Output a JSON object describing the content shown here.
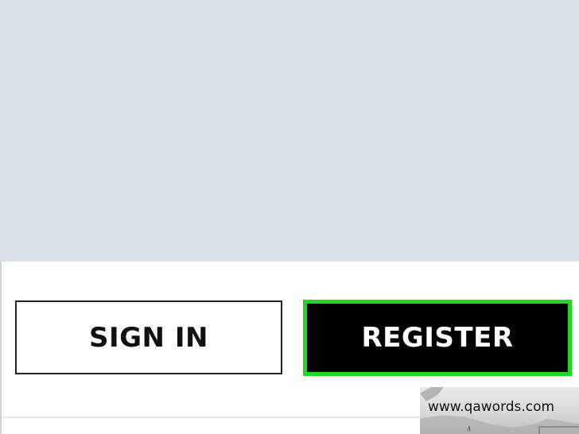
{
  "auth": {
    "sign_in_label": "SIGN IN",
    "register_label": "REGISTER"
  },
  "watermark": {
    "text": "www.qawords.com"
  },
  "colors": {
    "hero_background": "#d9dfe8",
    "register_background": "#000000",
    "register_highlight": "#22d81c",
    "sign_in_border": "#222222"
  }
}
